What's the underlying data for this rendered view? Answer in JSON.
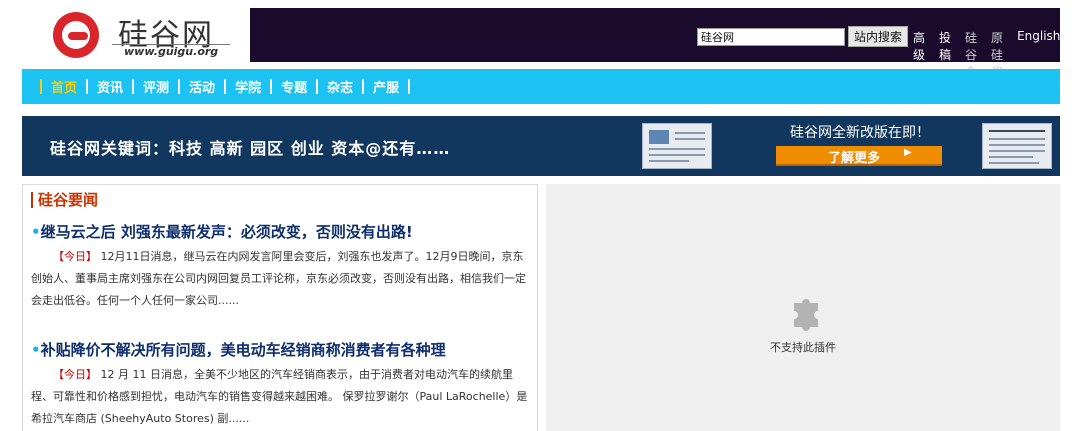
{
  "header": {
    "logo_cn": "硅谷网",
    "logo_en": "www.guigu.org",
    "search": {
      "value": "硅谷网",
      "button": "站内搜索"
    },
    "links": [
      {
        "label": "高级搜索",
        "dim": false
      },
      {
        "label": "投稿爆料",
        "dim": false
      },
      {
        "label": "硅谷会",
        "dim": true
      },
      {
        "label": "原硅奖",
        "dim": true
      },
      {
        "label": "English",
        "dim": false
      }
    ]
  },
  "nav": {
    "items": [
      {
        "label": "首页",
        "active": true
      },
      {
        "label": "资讯",
        "active": false
      },
      {
        "label": "评测",
        "active": false
      },
      {
        "label": "活动",
        "active": false
      },
      {
        "label": "学院",
        "active": false
      },
      {
        "label": "专题",
        "active": false
      },
      {
        "label": "杂志",
        "active": false
      },
      {
        "label": "产服",
        "active": false
      }
    ]
  },
  "banner": {
    "keywords": "硅谷网关键词：科技 高新 园区 创业 资本@还有……",
    "title": "硅谷网全新改版在即！",
    "button": "了解更多",
    "arrow": "▶"
  },
  "news": {
    "section_title": "硅谷要闻",
    "articles": [
      {
        "title": "继马云之后 刘强东最新发声：必须改变，否则没有出路!",
        "tag": "【今日】",
        "body": " 12月11日消息，继马云在内网发言阿里会变后，刘强东也发声了。12月9日晚间，京东创始人、董事局主席刘强东在公司内网回复员工评论称，京东必须改变，否则没有出路，相信我们一定会走出低谷。任何一个人任何一家公司......"
      },
      {
        "title": "补贴降价不解决所有问题，美电动车经销商称消费者有各种理",
        "tag": "【今日】",
        "body": " 12 月 11 日消息，全美不少地区的汽车经销商表示，由于消费者对电动汽车的续航里程、可靠性和价格感到担忧，电动汽车的销售变得越来越困难。 保罗拉罗谢尔（Paul LaRochelle）是希拉汽车商店 (SheehyAuto Stores) 副......"
      }
    ]
  },
  "plugin": {
    "message": "不支持此插件",
    "icon": "puzzle-icon"
  },
  "colors": {
    "nav_bg": "#1cc3f2",
    "header_dark": "#1a0b2c",
    "banner_bg": "#12375f",
    "accent_red": "#cc3300",
    "title_blue": "#0e2f6e"
  }
}
